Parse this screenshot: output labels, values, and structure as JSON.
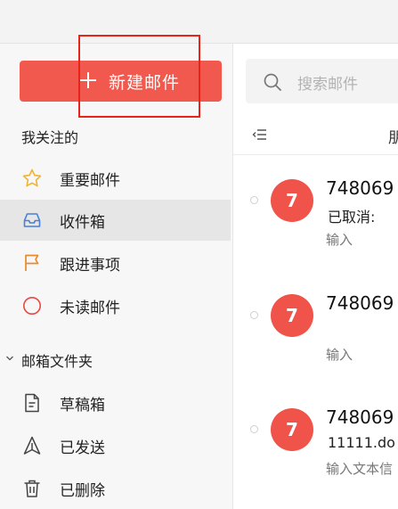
{
  "sidebar": {
    "compose_label": "新建邮件",
    "followed_title": "我关注的",
    "followed_items": [
      {
        "label": "重要邮件",
        "icon": "star-icon",
        "color": "#f2b333"
      },
      {
        "label": "收件箱",
        "icon": "inbox-icon",
        "color": "#4a7fd6",
        "active": true
      },
      {
        "label": "跟进事项",
        "icon": "flag-icon",
        "color": "#e98a2c"
      },
      {
        "label": "未读邮件",
        "icon": "unread-circle-icon",
        "color": "#e64a43"
      }
    ],
    "folders_title": "邮箱文件夹",
    "folder_items": [
      {
        "label": "草稿箱",
        "icon": "draft-document-icon"
      },
      {
        "label": "已发送",
        "icon": "sent-paper-plane-icon"
      },
      {
        "label": "已删除",
        "icon": "trash-icon"
      }
    ]
  },
  "main": {
    "search_placeholder": "搜索邮件",
    "toolbar_cut_text": "朋",
    "mails": [
      {
        "avatar": "7",
        "sender": "748069",
        "subject": "已取消:",
        "preview": "输入"
      },
      {
        "avatar": "7",
        "sender": "748069",
        "subject": "",
        "preview": "输入"
      },
      {
        "avatar": "7",
        "sender": "748069",
        "subject": "11111.do",
        "preview": "输入文本信"
      }
    ]
  },
  "colors": {
    "accent": "#f1584e",
    "highlight_box": "#e8231a"
  }
}
